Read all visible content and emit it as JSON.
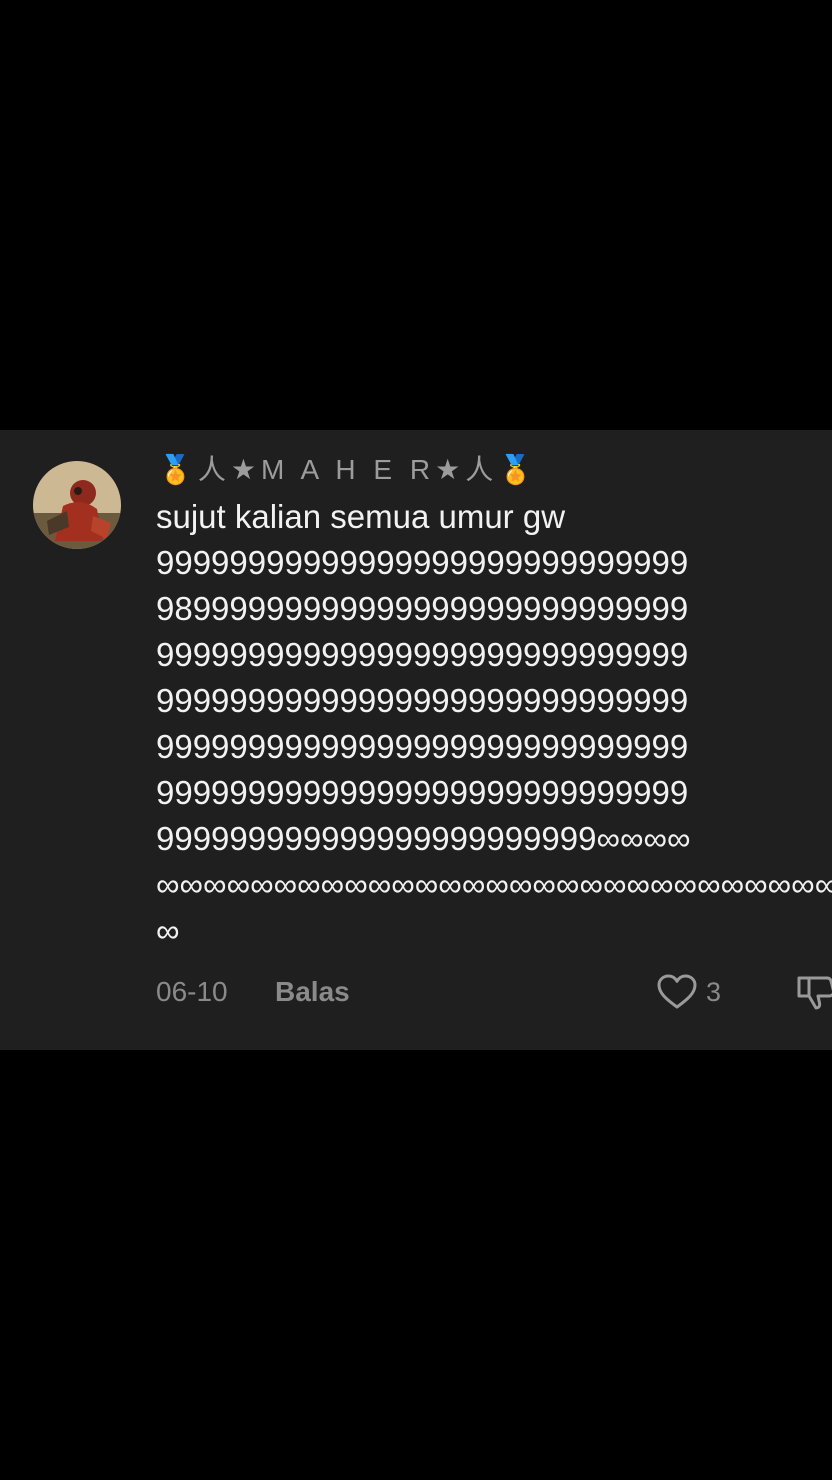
{
  "comment": {
    "username": "🏅人★M A H E R★人🏅",
    "lines": [
      "sujut kalian semua umur gw",
      "99999999999999999999999999999",
      "98999999999999999999999999999",
      "99999999999999999999999999999",
      "99999999999999999999999999999",
      "99999999999999999999999999999",
      "99999999999999999999999999999",
      "999999999999999999999999∞∞∞∞",
      "∞∞∞∞∞∞∞∞∞∞∞∞∞∞∞∞∞∞∞∞∞∞∞∞∞∞∞∞∞∞",
      "∞"
    ],
    "date": "06-10",
    "reply_label": "Balas",
    "like_count": "3",
    "icons": {
      "avatar": "user-avatar-photo",
      "like": "heart-icon",
      "dislike": "thumbs-down-icon"
    },
    "colors": {
      "card_background": "#1f1f1f",
      "page_background": "#000000",
      "text": "#f2f2f2",
      "muted": "#8a8a8a"
    }
  }
}
